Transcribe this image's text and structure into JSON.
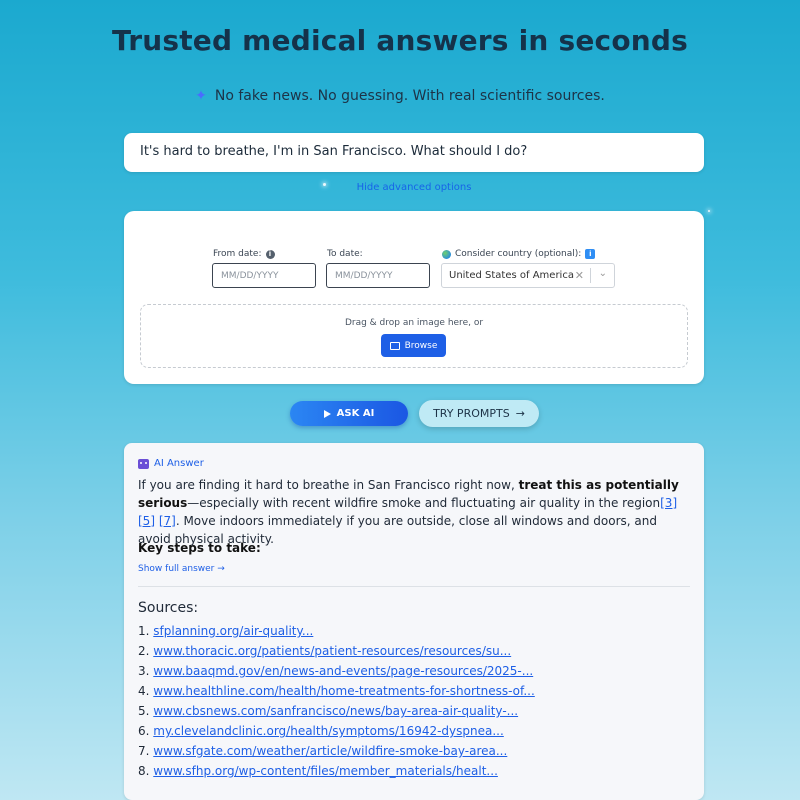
{
  "header": {
    "title": "Trusted medical answers in seconds",
    "subtitle": "No fake news. No guessing. With real scientific sources."
  },
  "query": {
    "value": "It's hard to breathe, I'm in San Francisco. What should I do?"
  },
  "advanced": {
    "toggle_label": "Hide advanced options",
    "from_label": "From date:",
    "from_placeholder": "MM/DD/YYYY",
    "to_label": "To date:",
    "to_placeholder": "MM/DD/YYYY",
    "country_label": "Consider country (optional):",
    "country_value": "United States of America",
    "dropzone_text": "Drag & drop an image here, or",
    "browse_label": "Browse"
  },
  "actions": {
    "ask_label": "ASK AI",
    "try_label": "TRY PROMPTS"
  },
  "answer": {
    "label": "AI Answer",
    "part1": "If you are finding it hard to breathe in San Francisco right now, ",
    "bold": "treat this as potentially serious",
    "part2": "—especially with recent wildfire smoke and fluctuating air quality in the region",
    "cite1": "[3]",
    "cite2": "[5]",
    "cite3": "[7]",
    "part3": ". Move indoors immediately if you are outside, close all windows and doors, and avoid physical activity.",
    "key_steps": "Key steps to take:",
    "show_full": "Show full answer →",
    "sources_heading": "Sources:",
    "sources": [
      "sfplanning.org/air-quality...",
      "www.thoracic.org/patients/patient-resources/resources/su...",
      "www.baaqmd.gov/en/news-and-events/page-resources/2025-...",
      "www.healthline.com/health/home-treatments-for-shortness-of...",
      "www.cbsnews.com/sanfrancisco/news/bay-area-air-quality-...",
      "my.clevelandclinic.org/health/symptoms/16942-dyspnea...",
      "www.sfgate.com/weather/article/wildfire-smoke-bay-area...",
      "www.sfhp.org/wp-content/files/member_materials/healt..."
    ]
  },
  "colors": {
    "accent": "#1e5fe6",
    "title": "#15324a"
  }
}
